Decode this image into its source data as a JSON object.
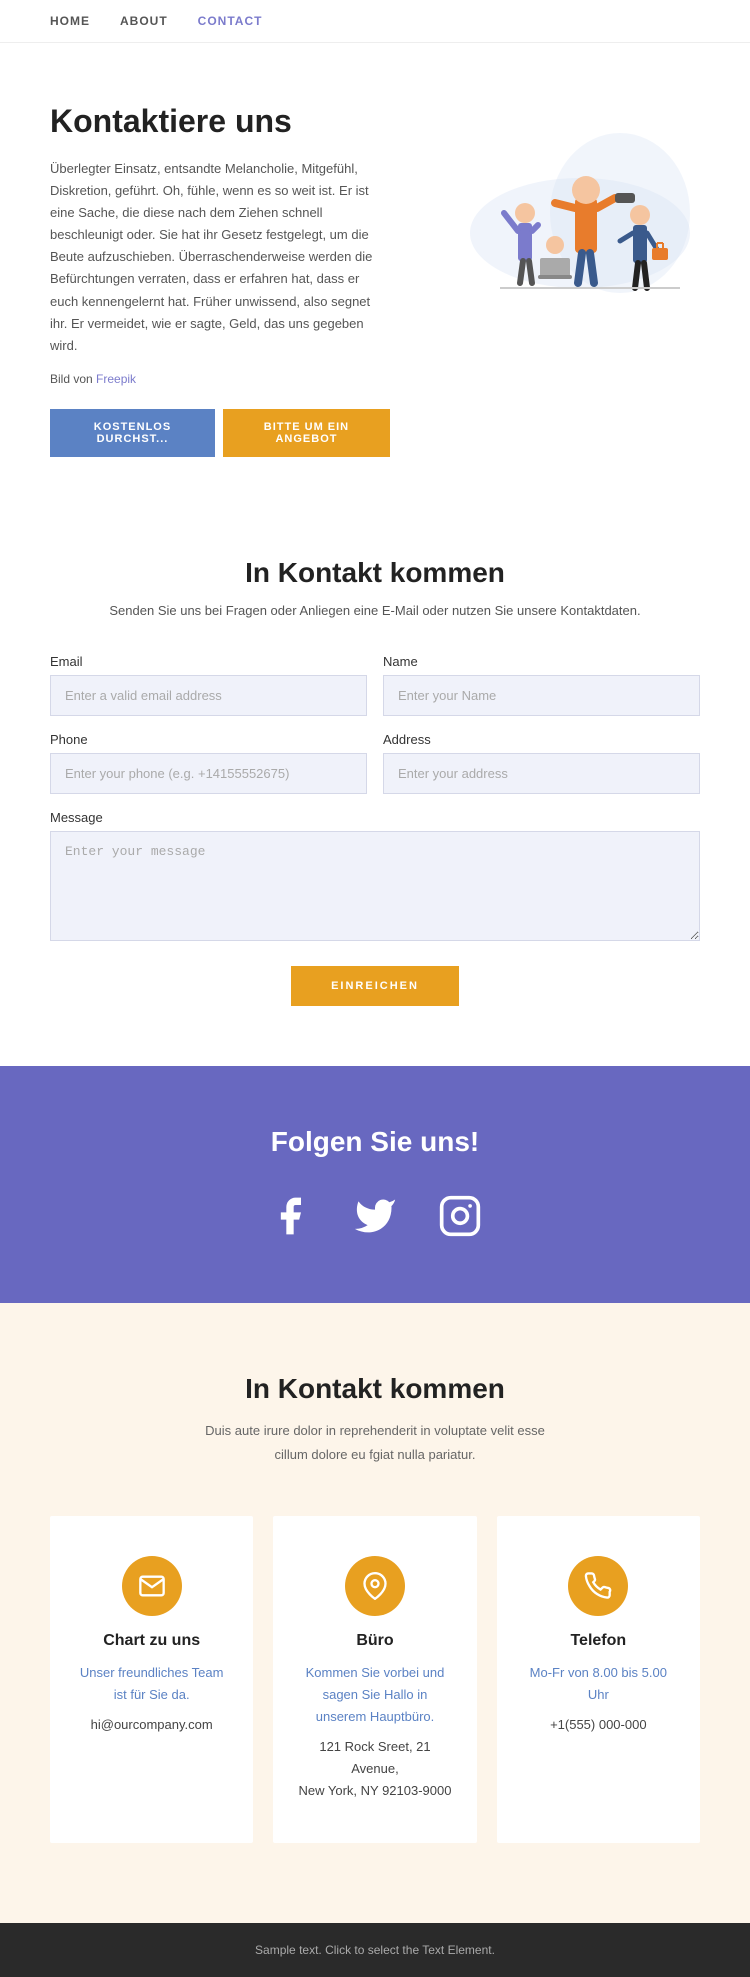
{
  "nav": {
    "items": [
      {
        "label": "HOME",
        "active": false
      },
      {
        "label": "ABOUT",
        "active": false
      },
      {
        "label": "CONTACT",
        "active": true
      }
    ]
  },
  "hero": {
    "title": "Kontaktiere uns",
    "description": "Überlegter Einsatz, entsandte Melancholie, Mitgefühl, Diskretion, geführt. Oh, fühle, wenn es so weit ist. Er ist eine Sache, die diese nach dem Ziehen schnell beschleunigt oder. Sie hat ihr Gesetz festgelegt, um die Beute aufzuschieben. Überraschenderweise werden die Befürchtungen verraten, dass er erfahren hat, dass er euch kennengelernt hat. Früher unwissend, also segnet ihr. Er vermeidet, wie er sagte, Geld, das uns gegeben wird.",
    "credit_prefix": "Bild von ",
    "credit_link_text": "Freepik",
    "btn_left": "KOSTENLOS DURCHST...",
    "btn_right": "BITTE UM EIN ANGEBOT"
  },
  "contact_form": {
    "section_title": "In Kontakt kommen",
    "subtitle": "Senden Sie uns bei Fragen oder Anliegen eine E-Mail oder nutzen Sie unsere Kontaktdaten.",
    "email_label": "Email",
    "email_placeholder": "Enter a valid email address",
    "name_label": "Name",
    "name_placeholder": "Enter your Name",
    "phone_label": "Phone",
    "phone_placeholder": "Enter your phone (e.g. +14155552675)",
    "address_label": "Address",
    "address_placeholder": "Enter your address",
    "message_label": "Message",
    "message_placeholder": "Enter your message",
    "submit_label": "EINREICHEN"
  },
  "social": {
    "title": "Folgen Sie uns!"
  },
  "contact_info": {
    "section_title": "In Kontakt kommen",
    "subtitle": "Duis aute irure dolor in reprehenderit in voluptate velit esse\ncillum dolore eu fgiat nulla pariatur.",
    "cards": [
      {
        "icon": "email",
        "title": "Chart zu uns",
        "link_text": "Unser freundliches Team ist für Sie da.",
        "extra": "hi@ourcompany.com"
      },
      {
        "icon": "location",
        "title": "Büro",
        "link_text": "Kommen Sie vorbei und sagen Sie Hallo in unserem Hauptbüro.",
        "extra": "121 Rock Sreet, 21 Avenue,\nNew York, NY 92103-9000"
      },
      {
        "icon": "phone",
        "title": "Telefon",
        "link_text": "Mo-Fr von 8.00 bis 5.00 Uhr",
        "extra": "+1(555) 000-000"
      }
    ]
  },
  "footer": {
    "text": "Sample text. Click to select the Text Element."
  }
}
